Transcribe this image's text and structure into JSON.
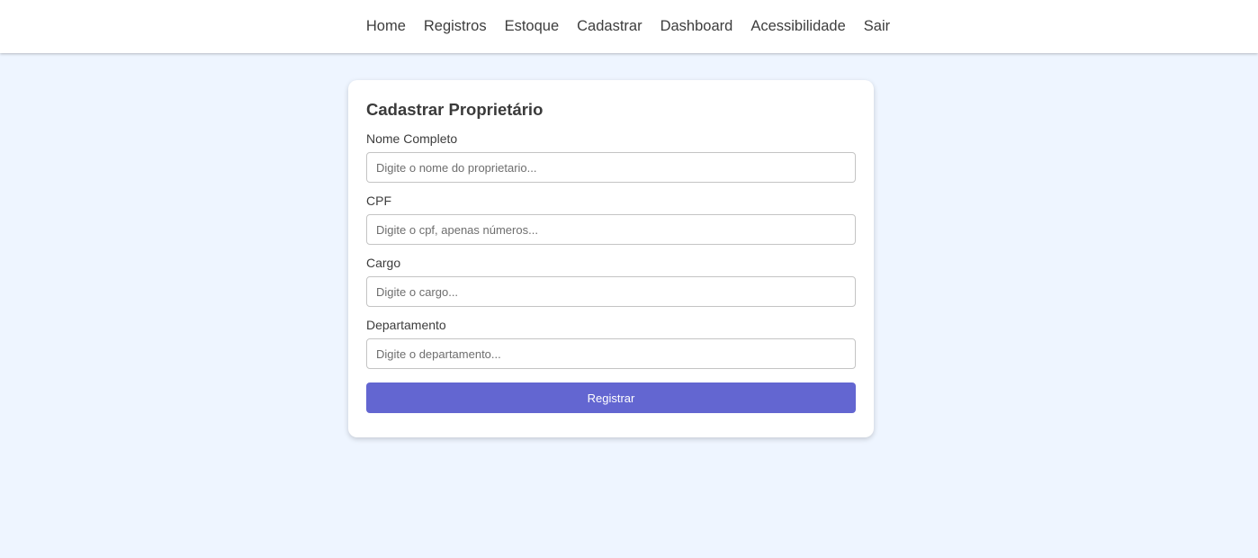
{
  "nav": {
    "items": [
      {
        "label": "Home"
      },
      {
        "label": "Registros"
      },
      {
        "label": "Estoque"
      },
      {
        "label": "Cadastrar"
      },
      {
        "label": "Dashboard"
      },
      {
        "label": "Acessibilidade"
      },
      {
        "label": "Sair"
      }
    ]
  },
  "form": {
    "title": "Cadastrar Proprietário",
    "fields": [
      {
        "label": "Nome Completo",
        "value": "",
        "placeholder": "Digite o nome do proprietario..."
      },
      {
        "label": "CPF",
        "value": "",
        "placeholder": "Digite o cpf, apenas números..."
      },
      {
        "label": "Cargo",
        "value": "",
        "placeholder": "Digite o cargo..."
      },
      {
        "label": "Departamento",
        "value": "",
        "placeholder": "Digite o departamento..."
      }
    ],
    "submit_label": "Registrar"
  },
  "colors": {
    "page_background": "#eef5ff",
    "accent": "#6366d1",
    "card_background": "#ffffff"
  }
}
